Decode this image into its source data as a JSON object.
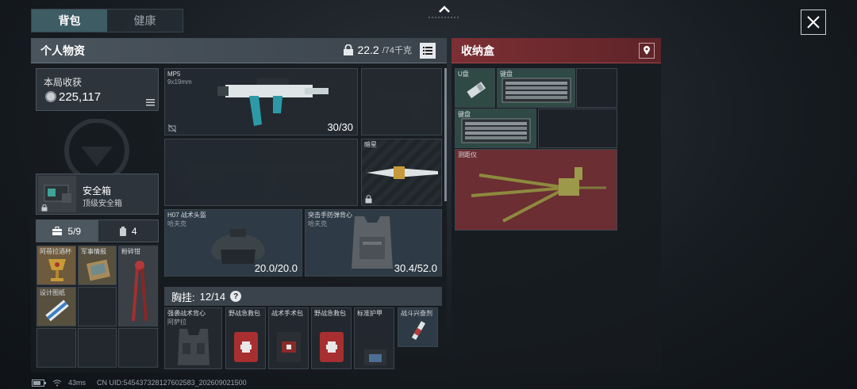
{
  "tabs": [
    {
      "label": "背包"
    },
    {
      "label": "健康"
    }
  ],
  "personal": {
    "title": "个人物资",
    "weight_current": "22.2",
    "weight_max": "/74千克"
  },
  "storage": {
    "title": "收纳盒"
  },
  "loot": {
    "title": "本局收获",
    "value": "225,117"
  },
  "safe": {
    "name": "安全箱",
    "sub": "顶级安全箱"
  },
  "pocket_tabs": [
    {
      "label": "5/9"
    },
    {
      "label": "4"
    }
  ],
  "pocket_items": [
    {
      "label": "阿蓓拉酒杯"
    },
    {
      "label": "军事情报"
    },
    {
      "label": "粉碎钳"
    },
    {
      "label": "设计图纸"
    }
  ],
  "weapons": {
    "primary": {
      "name": "MP5",
      "ammo_type": "9x19mm",
      "ammo": "30/30"
    },
    "melee": {
      "name": "暗星"
    }
  },
  "armor": {
    "helmet": {
      "name": "H07 战术头盔",
      "brand": "哈夫克",
      "durability": "20.0/20.0"
    },
    "vest": {
      "name": "突击手防弹背心",
      "brand": "哈夫克",
      "durability": "30.4/52.0"
    }
  },
  "chest_rig": {
    "label": "胸挂:",
    "count": "12/14",
    "help": "?",
    "items": [
      {
        "label": "强袭战术背心",
        "sub": "阿萨拉"
      },
      {
        "label": "野战急救包"
      },
      {
        "label": "战术手术包"
      },
      {
        "label": "野战急救包"
      },
      {
        "label": "标准护甲"
      },
      {
        "label": "战斗兴奋剂"
      }
    ]
  },
  "storage_items": [
    {
      "label": "U盘"
    },
    {
      "label": "键盘"
    },
    {
      "label": "键盘"
    },
    {
      "label": "测距仪"
    }
  ],
  "status": {
    "ping": "43ms",
    "uid": "CN UID:545437328127602583_202609021500"
  }
}
